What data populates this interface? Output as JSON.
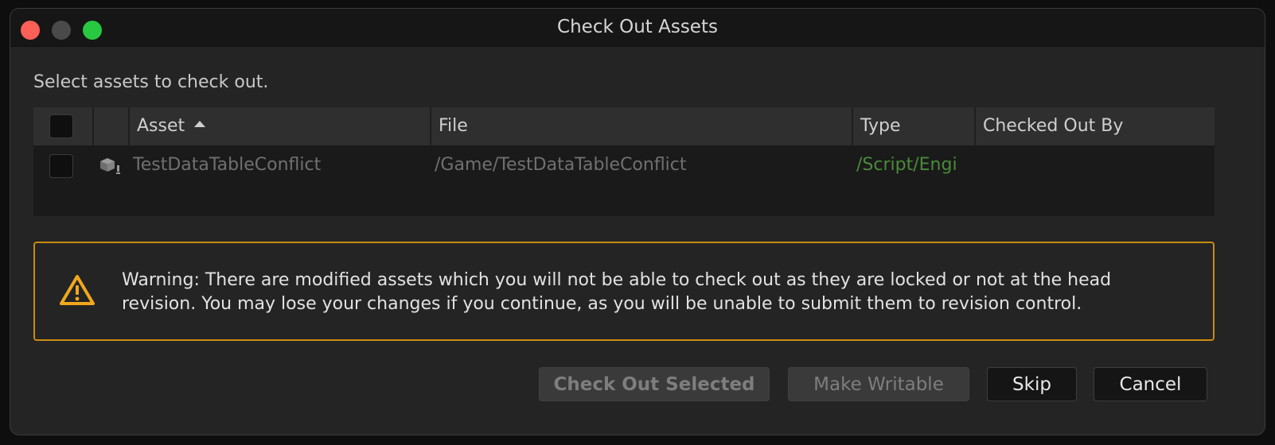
{
  "window": {
    "title": "Check Out Assets"
  },
  "prompt": "Select assets to check out.",
  "table": {
    "columns": {
      "asset": "Asset",
      "file": "File",
      "type": "Type",
      "checked_out_by": "Checked Out By"
    },
    "rows": [
      {
        "asset": "TestDataTableConflict",
        "file": "/Game/TestDataTableConflict",
        "type": "/Script/Engi",
        "checked_out_by": "",
        "icon": "data-table-asset-icon"
      }
    ]
  },
  "warning": {
    "icon": "warning-triangle-icon",
    "text": "Warning: There are modified assets which you will not be able to check out as they are locked or not at the head revision. You may lose your changes if you continue, as you will be unable to submit them to revision control."
  },
  "buttons": {
    "check_out_selected": "Check Out Selected",
    "make_writable": "Make Writable",
    "skip": "Skip",
    "cancel": "Cancel"
  },
  "colors": {
    "warning_border": "#c98c10",
    "type_text": "#4a8a3a"
  }
}
